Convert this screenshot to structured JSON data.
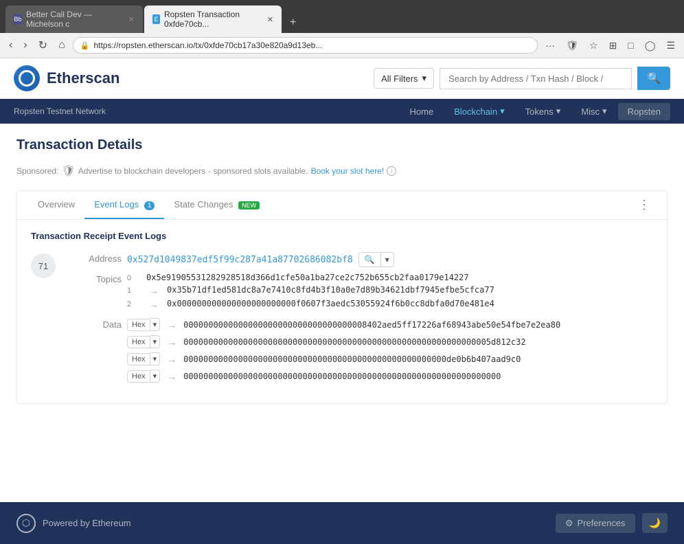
{
  "browser": {
    "tabs": [
      {
        "id": "tab1",
        "favicon_text": "Bb",
        "favicon_bg": "#4a4a8a",
        "label": "Better Call Dev — Michelson c",
        "active": false
      },
      {
        "id": "tab2",
        "favicon_text": "E",
        "favicon_bg": "#3498db",
        "label": "Ropsten Transaction 0xfde70cb...",
        "active": true
      }
    ],
    "new_tab_label": "+",
    "address": "https://ropsten.etherscan.io/tx/0xfde70cb17a30e820a9d13eb...",
    "more_btn": "···",
    "window_btns": {
      "min": "—",
      "max": "□",
      "close": "✕"
    }
  },
  "header": {
    "logo_text": "Etherscan",
    "filter_label": "All Filters",
    "search_placeholder": "Search by Address / Txn Hash / Block /",
    "search_btn_icon": "🔍"
  },
  "nav": {
    "network_label": "Ropsten Testnet Network",
    "links": [
      {
        "label": "Home",
        "active": false
      },
      {
        "label": "Blockchain",
        "active": true,
        "has_arrow": true
      },
      {
        "label": "Tokens",
        "active": false,
        "has_arrow": true
      },
      {
        "label": "Misc",
        "active": false,
        "has_arrow": true
      }
    ],
    "network_btn": "Ropsten"
  },
  "page": {
    "title": "Transaction Details",
    "sponsored": {
      "prefix": "Sponsored:",
      "text": " Advertise to blockchain developers",
      "suffix": "- sponsored slots available.",
      "link_text": "Book your slot here!",
      "info": "i"
    }
  },
  "card": {
    "tabs": [
      {
        "label": "Overview",
        "active": false
      },
      {
        "label": "Event Logs",
        "badge": "1",
        "active": true
      },
      {
        "label": "State Changes",
        "new_badge": "NEW",
        "active": false
      }
    ],
    "menu_icon": "⋮",
    "section_title": "Transaction Receipt Event Logs",
    "log_entry": {
      "index": 71,
      "address_label": "Address",
      "address_value": "0x527d1049837edf5f99c287a41a87702686082bf8",
      "search_btn": "🔍",
      "dropdown_btn": "▾",
      "topics_label": "Topics",
      "topics": [
        {
          "idx": "0",
          "value": "0x5e91905531282928518d366d1cfe50a1ba27ce2c752b655cb2faa0179e14227"
        },
        {
          "idx": "1",
          "arrow": "→",
          "value": "0x35b71df1ed581dc8a7e7410c8fd4b3f10a0e7d89b34621dbf7945efbe5cfca77"
        },
        {
          "idx": "2",
          "arrow": "→",
          "value": "0x000000000000000000000000f0607f3aedc53055924f6b0cc8dbfa0d70e481e4"
        }
      ],
      "data_label": "Data",
      "data_rows": [
        {
          "format": "Hex",
          "arrow": "→",
          "value": "0000000000000000000000000000000000008402aed5ff17226af68943abe50e54fbe7e2ea80"
        },
        {
          "format": "Hex",
          "arrow": "→",
          "value": "00000000000000000000000000000000000000000000000000000000000005d812c32"
        },
        {
          "format": "Hex",
          "arrow": "→",
          "value": "00000000000000000000000000000000000000000000000000000de0b6b407aad9c0"
        },
        {
          "format": "Hex",
          "arrow": "→",
          "value": "0000000000000000000000000000000000000000000000000000000000000000"
        }
      ]
    }
  },
  "footer": {
    "powered_by": "Powered by Ethereum",
    "preferences_btn": "Preferences",
    "moon_btn": "🌙"
  }
}
